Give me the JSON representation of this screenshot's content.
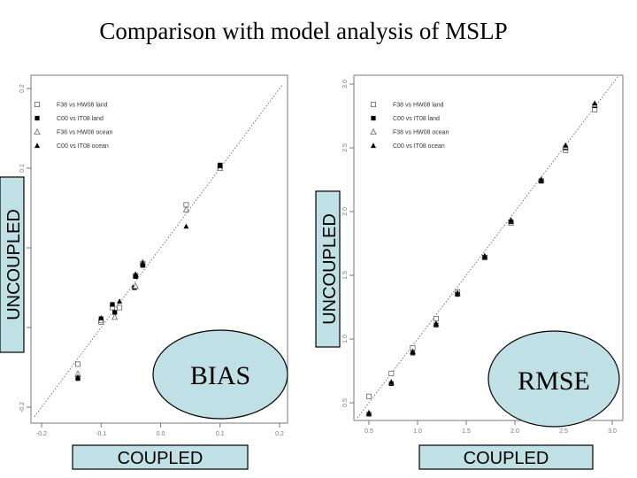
{
  "title": "Comparison with model analysis of MSLP",
  "legend": [
    "F38 vs HW08 land",
    "C00 vs IT08 land",
    "F38 vs HW08 ocean",
    "C00 vs IT08 ocean"
  ],
  "chart_data": [
    {
      "type": "scatter",
      "label": "BIAS",
      "xlabel": "COUPLED",
      "ylabel": "UNCOUPLED",
      "xlim": [
        -0.2,
        0.2
      ],
      "ylim": [
        -0.2,
        0.2
      ],
      "xticks": [
        "-0.2",
        "-0.1",
        "0.0",
        "0.1",
        "0.2"
      ],
      "yticks": [
        "-0.2",
        "-0.1",
        "0.0",
        "0.1",
        "0.2"
      ],
      "reference_line": "y = x (dotted)",
      "series": [
        {
          "name": "F38 vs HW08 land",
          "marker": "open-square",
          "x": [
            0.1,
            0.043,
            -0.03,
            -0.042,
            -0.069,
            -0.081,
            -0.1,
            -0.139
          ],
          "y": [
            0.102,
            0.054,
            -0.02,
            -0.035,
            -0.075,
            -0.075,
            -0.093,
            -0.146
          ]
        },
        {
          "name": "C00 vs IT08 land",
          "marker": "filled-square",
          "x": [
            0.1,
            -0.03,
            -0.042,
            -0.044,
            -0.081,
            -0.077,
            -0.1,
            -0.139
          ],
          "y": [
            0.104,
            -0.022,
            -0.036,
            -0.05,
            -0.071,
            -0.081,
            -0.089,
            -0.164
          ]
        },
        {
          "name": "F38 vs HW08 ocean",
          "marker": "open-triangle",
          "x": [
            0.1,
            0.043,
            -0.03,
            -0.042,
            -0.077,
            -0.1,
            -0.139
          ],
          "y": [
            0.1,
            0.048,
            -0.018,
            -0.048,
            -0.087,
            -0.091,
            -0.158
          ]
        },
        {
          "name": "C00 vs IT08 ocean",
          "marker": "filled-triangle",
          "x": [
            0.1,
            0.043,
            -0.03,
            -0.042,
            -0.069,
            -0.1,
            -0.139
          ],
          "y": [
            0.103,
            0.027,
            -0.019,
            -0.033,
            -0.067,
            -0.088,
            -0.162
          ]
        }
      ]
    },
    {
      "type": "scatter",
      "label": "RMSE",
      "xlabel": "COUPLED",
      "ylabel": "UNCOUPLED",
      "xlim": [
        0.5,
        3.0
      ],
      "ylim": [
        0.5,
        3.0
      ],
      "xticks": [
        "0.5",
        "1.0",
        "1.5",
        "2.0",
        "2.5",
        "3.0"
      ],
      "yticks": [
        "0.5",
        "1.0",
        "1.5",
        "2.0",
        "2.5",
        "3.0"
      ],
      "reference_line": "y = x (dotted)",
      "series": [
        {
          "name": "F38 vs HW08 land",
          "marker": "open-square",
          "x": [
            0.5,
            0.73,
            0.95,
            1.19,
            1.41,
            1.69,
            1.96,
            2.27,
            2.52,
            2.82
          ],
          "y": [
            0.55,
            0.73,
            0.93,
            1.16,
            1.37,
            1.64,
            1.91,
            2.24,
            2.48,
            2.8
          ]
        },
        {
          "name": "C00 vs IT08 land",
          "marker": "filled-square",
          "x": [
            0.5,
            0.73,
            0.95,
            1.19,
            1.41,
            1.69,
            1.96,
            2.27,
            2.52,
            2.82
          ],
          "y": [
            0.41,
            0.65,
            0.89,
            1.11,
            1.35,
            1.64,
            1.92,
            2.24,
            2.5,
            2.83
          ]
        },
        {
          "name": "F38 vs HW08 ocean",
          "marker": "open-triangle",
          "x": [
            0.5,
            0.73,
            0.95,
            1.19,
            1.41,
            1.69,
            1.96,
            2.27,
            2.52,
            2.82
          ],
          "y": [
            0.42,
            0.66,
            0.9,
            1.12,
            1.36,
            1.65,
            1.93,
            2.25,
            2.51,
            2.84
          ]
        },
        {
          "name": "C00 vs IT08 ocean",
          "marker": "filled-triangle",
          "x": [
            0.5,
            0.73,
            0.95,
            1.19,
            1.41,
            1.69,
            1.96,
            2.27,
            2.52,
            2.82
          ],
          "y": [
            0.42,
            0.66,
            0.9,
            1.12,
            1.36,
            1.65,
            1.93,
            2.25,
            2.52,
            2.85
          ]
        }
      ]
    }
  ]
}
